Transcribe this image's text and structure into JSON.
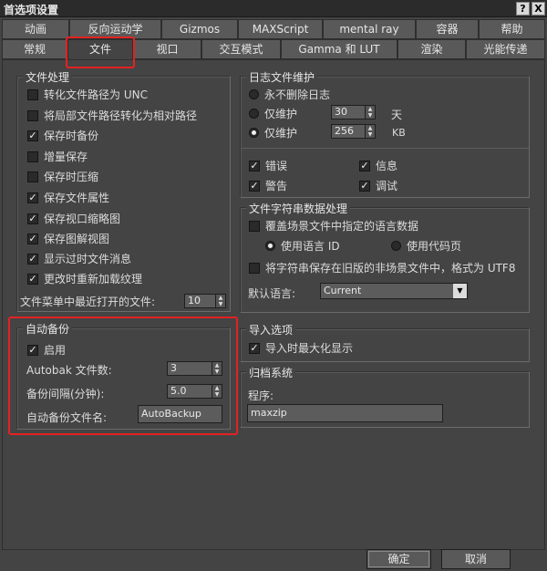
{
  "window": {
    "title": "首选项设置",
    "help_button": "?",
    "close_button": "X"
  },
  "tabs_row1": [
    {
      "label": "动画"
    },
    {
      "label": "反向运动学"
    },
    {
      "label": "Gizmos"
    },
    {
      "label": "MAXScript"
    },
    {
      "label": "mental ray"
    },
    {
      "label": "容器"
    },
    {
      "label": "帮助"
    }
  ],
  "tabs_row2": [
    {
      "label": "常规"
    },
    {
      "label": "文件"
    },
    {
      "label": "视口"
    },
    {
      "label": "交互模式"
    },
    {
      "label": "Gamma 和 LUT"
    },
    {
      "label": "渲染"
    },
    {
      "label": "光能传递"
    }
  ],
  "active_tab": "文件",
  "file_handling": {
    "title": "文件处理",
    "options": [
      {
        "label": "转化文件路径为 UNC",
        "checked": false
      },
      {
        "label": "将局部文件路径转化为相对路径",
        "checked": false
      },
      {
        "label": "保存时备份",
        "checked": true
      },
      {
        "label": "增量保存",
        "checked": false
      },
      {
        "label": "保存时压缩",
        "checked": false
      },
      {
        "label": "保存文件属性",
        "checked": true
      },
      {
        "label": "保存视口缩略图",
        "checked": true
      },
      {
        "label": "保存图解视图",
        "checked": true
      },
      {
        "label": "显示过时文件消息",
        "checked": true
      },
      {
        "label": "更改时重新加载纹理",
        "checked": true
      }
    ],
    "recent_files_label": "文件菜单中最近打开的文件:",
    "recent_files_value": "10"
  },
  "auto_backup": {
    "title": "自动备份",
    "enable_label": "启用",
    "enable_checked": true,
    "count_label": "Autobak 文件数:",
    "count_value": "3",
    "interval_label": "备份间隔(分钟):",
    "interval_value": "5.0",
    "filename_label": "自动备份文件名:",
    "filename_value": "AutoBackup"
  },
  "log_maintenance": {
    "title": "日志文件维护",
    "never_delete_label": "永不删除日志",
    "keep_days_label": "仅维护",
    "keep_days_value": "30",
    "days_unit": "天",
    "keep_kb_label": "仅维护",
    "keep_kb_value": "256",
    "kb_unit": "KB",
    "selected_option": "kb",
    "flags": [
      {
        "label": "错误",
        "checked": true
      },
      {
        "label": "信息",
        "checked": true
      },
      {
        "label": "警告",
        "checked": true
      },
      {
        "label": "调试",
        "checked": true
      }
    ]
  },
  "string_data": {
    "title": "文件字符串数据处理",
    "override_label": "覆盖场景文件中指定的语言数据",
    "override_checked": false,
    "use_language_id": "使用语言 ID",
    "use_code_page": "使用代码页",
    "save_legacy_label": "将字符串保存在旧版的非场景文件中，格式为 UTF8",
    "save_legacy_checked": false,
    "default_language_label": "默认语言:",
    "default_language_value": "Current"
  },
  "import_options": {
    "title": "导入选项",
    "maximize_label": "导入时最大化显示",
    "maximize_checked": true
  },
  "archive": {
    "title": "归档系统",
    "program_label": "程序:",
    "program_value": "maxzip"
  },
  "footer": {
    "ok_label": "确定",
    "cancel_label": "取消"
  },
  "colors": {
    "background": "#444444",
    "highlight": "#e32222"
  }
}
